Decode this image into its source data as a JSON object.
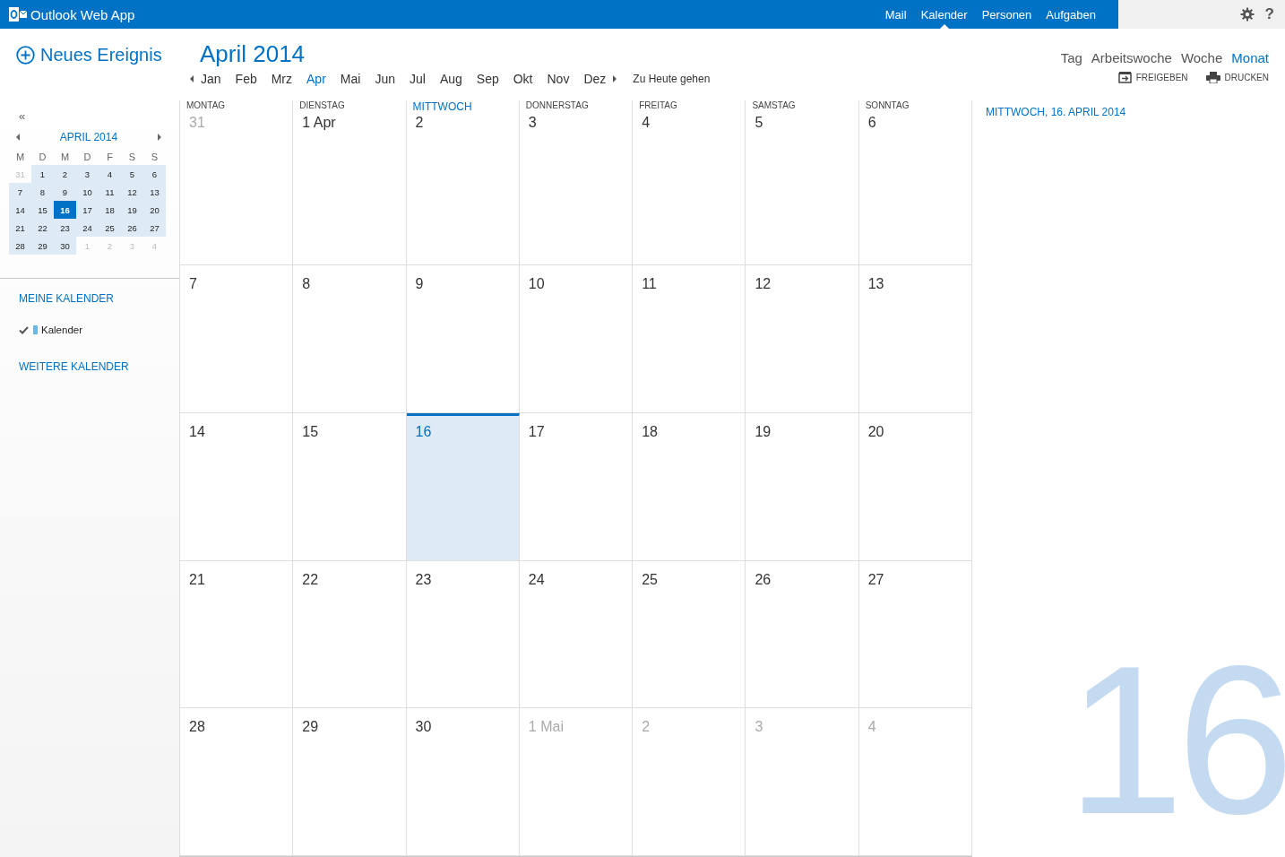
{
  "header": {
    "app_title": "Outlook Web App",
    "help": "?",
    "nav_items": [
      {
        "label": "Mail",
        "selected": false
      },
      {
        "label": "Kalender",
        "selected": true
      },
      {
        "label": "Personen",
        "selected": false
      },
      {
        "label": "Aufgaben",
        "selected": false
      }
    ]
  },
  "new_event": {
    "label": "Neues Ereignis"
  },
  "toolbar": {
    "month_title": "April 2014",
    "months": [
      {
        "label": "Jan",
        "selected": false
      },
      {
        "label": "Feb",
        "selected": false
      },
      {
        "label": "Mrz",
        "selected": false
      },
      {
        "label": "Apr",
        "selected": true
      },
      {
        "label": "Mai",
        "selected": false
      },
      {
        "label": "Jun",
        "selected": false
      },
      {
        "label": "Jul",
        "selected": false
      },
      {
        "label": "Aug",
        "selected": false
      },
      {
        "label": "Sep",
        "selected": false
      },
      {
        "label": "Okt",
        "selected": false
      },
      {
        "label": "Nov",
        "selected": false
      },
      {
        "label": "Dez",
        "selected": false
      }
    ],
    "today_link": "Zu Heute gehen",
    "views": [
      {
        "label": "Tag",
        "selected": false
      },
      {
        "label": "Arbeitswoche",
        "selected": false
      },
      {
        "label": "Woche",
        "selected": false
      },
      {
        "label": "Monat",
        "selected": true
      }
    ],
    "actions": [
      {
        "kind": "share",
        "label": "FREIGEBEN"
      },
      {
        "kind": "print",
        "label": "DRUCKEN"
      }
    ]
  },
  "mini_calendar": {
    "collapse": "«",
    "title": "APRIL 2014",
    "weekdays": [
      "M",
      "D",
      "M",
      "D",
      "F",
      "S",
      "S"
    ],
    "weeks": [
      [
        {
          "label": "31",
          "other_month": true,
          "selected": false
        },
        {
          "label": "1",
          "other_month": false,
          "selected": false
        },
        {
          "label": "2",
          "other_month": false,
          "selected": false
        },
        {
          "label": "3",
          "other_month": false,
          "selected": false
        },
        {
          "label": "4",
          "other_month": false,
          "selected": false
        },
        {
          "label": "5",
          "other_month": false,
          "selected": false
        },
        {
          "label": "6",
          "other_month": false,
          "selected": false
        }
      ],
      [
        {
          "label": "7",
          "other_month": false,
          "selected": false
        },
        {
          "label": "8",
          "other_month": false,
          "selected": false
        },
        {
          "label": "9",
          "other_month": false,
          "selected": false
        },
        {
          "label": "10",
          "other_month": false,
          "selected": false
        },
        {
          "label": "11",
          "other_month": false,
          "selected": false
        },
        {
          "label": "12",
          "other_month": false,
          "selected": false
        },
        {
          "label": "13",
          "other_month": false,
          "selected": false
        }
      ],
      [
        {
          "label": "14",
          "other_month": false,
          "selected": false
        },
        {
          "label": "15",
          "other_month": false,
          "selected": false
        },
        {
          "label": "16",
          "other_month": false,
          "selected": true
        },
        {
          "label": "17",
          "other_month": false,
          "selected": false
        },
        {
          "label": "18",
          "other_month": false,
          "selected": false
        },
        {
          "label": "19",
          "other_month": false,
          "selected": false
        },
        {
          "label": "20",
          "other_month": false,
          "selected": false
        }
      ],
      [
        {
          "label": "21",
          "other_month": false,
          "selected": false
        },
        {
          "label": "22",
          "other_month": false,
          "selected": false
        },
        {
          "label": "23",
          "other_month": false,
          "selected": false
        },
        {
          "label": "24",
          "other_month": false,
          "selected": false
        },
        {
          "label": "25",
          "other_month": false,
          "selected": false
        },
        {
          "label": "26",
          "other_month": false,
          "selected": false
        },
        {
          "label": "27",
          "other_month": false,
          "selected": false
        }
      ],
      [
        {
          "label": "28",
          "other_month": false,
          "selected": false
        },
        {
          "label": "29",
          "other_month": false,
          "selected": false
        },
        {
          "label": "30",
          "other_month": false,
          "selected": false
        },
        {
          "label": "1",
          "other_month": true,
          "selected": false
        },
        {
          "label": "2",
          "other_month": true,
          "selected": false
        },
        {
          "label": "3",
          "other_month": true,
          "selected": false
        },
        {
          "label": "4",
          "other_month": true,
          "selected": false
        }
      ]
    ]
  },
  "my_calendars": {
    "heading": "MEINE KALENDER",
    "items": [
      {
        "label": "Kalender",
        "checked": true,
        "color": "#6ab8e8"
      }
    ]
  },
  "other_calendars": {
    "heading": "WEITERE KALENDER"
  },
  "month_grid": {
    "weekdays": [
      {
        "label": "MONTAG",
        "today": false
      },
      {
        "label": "DIENSTAG",
        "today": false
      },
      {
        "label": "MITTWOCH",
        "today": true
      },
      {
        "label": "DONNERSTAG",
        "today": false
      },
      {
        "label": "FREITAG",
        "today": false
      },
      {
        "label": "SAMSTAG",
        "today": false
      },
      {
        "label": "SONNTAG",
        "today": false
      }
    ],
    "weeks": [
      [
        {
          "label": "31",
          "other_month": true,
          "today": false
        },
        {
          "label": "1 Apr",
          "other_month": false,
          "today": false
        },
        {
          "label": "2",
          "other_month": false,
          "today": false
        },
        {
          "label": "3",
          "other_month": false,
          "today": false
        },
        {
          "label": "4",
          "other_month": false,
          "today": false
        },
        {
          "label": "5",
          "other_month": false,
          "today": false
        },
        {
          "label": "6",
          "other_month": false,
          "today": false
        }
      ],
      [
        {
          "label": "7",
          "other_month": false,
          "today": false
        },
        {
          "label": "8",
          "other_month": false,
          "today": false
        },
        {
          "label": "9",
          "other_month": false,
          "today": false
        },
        {
          "label": "10",
          "other_month": false,
          "today": false
        },
        {
          "label": "11",
          "other_month": false,
          "today": false
        },
        {
          "label": "12",
          "other_month": false,
          "today": false
        },
        {
          "label": "13",
          "other_month": false,
          "today": false
        }
      ],
      [
        {
          "label": "14",
          "other_month": false,
          "today": false
        },
        {
          "label": "15",
          "other_month": false,
          "today": false
        },
        {
          "label": "16",
          "other_month": false,
          "today": true
        },
        {
          "label": "17",
          "other_month": false,
          "today": false
        },
        {
          "label": "18",
          "other_month": false,
          "today": false
        },
        {
          "label": "19",
          "other_month": false,
          "today": false
        },
        {
          "label": "20",
          "other_month": false,
          "today": false
        }
      ],
      [
        {
          "label": "21",
          "other_month": false,
          "today": false
        },
        {
          "label": "22",
          "other_month": false,
          "today": false
        },
        {
          "label": "23",
          "other_month": false,
          "today": false
        },
        {
          "label": "24",
          "other_month": false,
          "today": false
        },
        {
          "label": "25",
          "other_month": false,
          "today": false
        },
        {
          "label": "26",
          "other_month": false,
          "today": false
        },
        {
          "label": "27",
          "other_month": false,
          "today": false
        }
      ],
      [
        {
          "label": "28",
          "other_month": false,
          "today": false
        },
        {
          "label": "29",
          "other_month": false,
          "today": false
        },
        {
          "label": "30",
          "other_month": false,
          "today": false
        },
        {
          "label": "1 Mai",
          "other_month": true,
          "today": false
        },
        {
          "label": "2",
          "other_month": true,
          "today": false
        },
        {
          "label": "3",
          "other_month": true,
          "today": false
        },
        {
          "label": "4",
          "other_month": true,
          "today": false
        }
      ]
    ]
  },
  "agenda": {
    "title": "MITTWOCH, 16. APRIL 2014",
    "big_day": "16"
  }
}
